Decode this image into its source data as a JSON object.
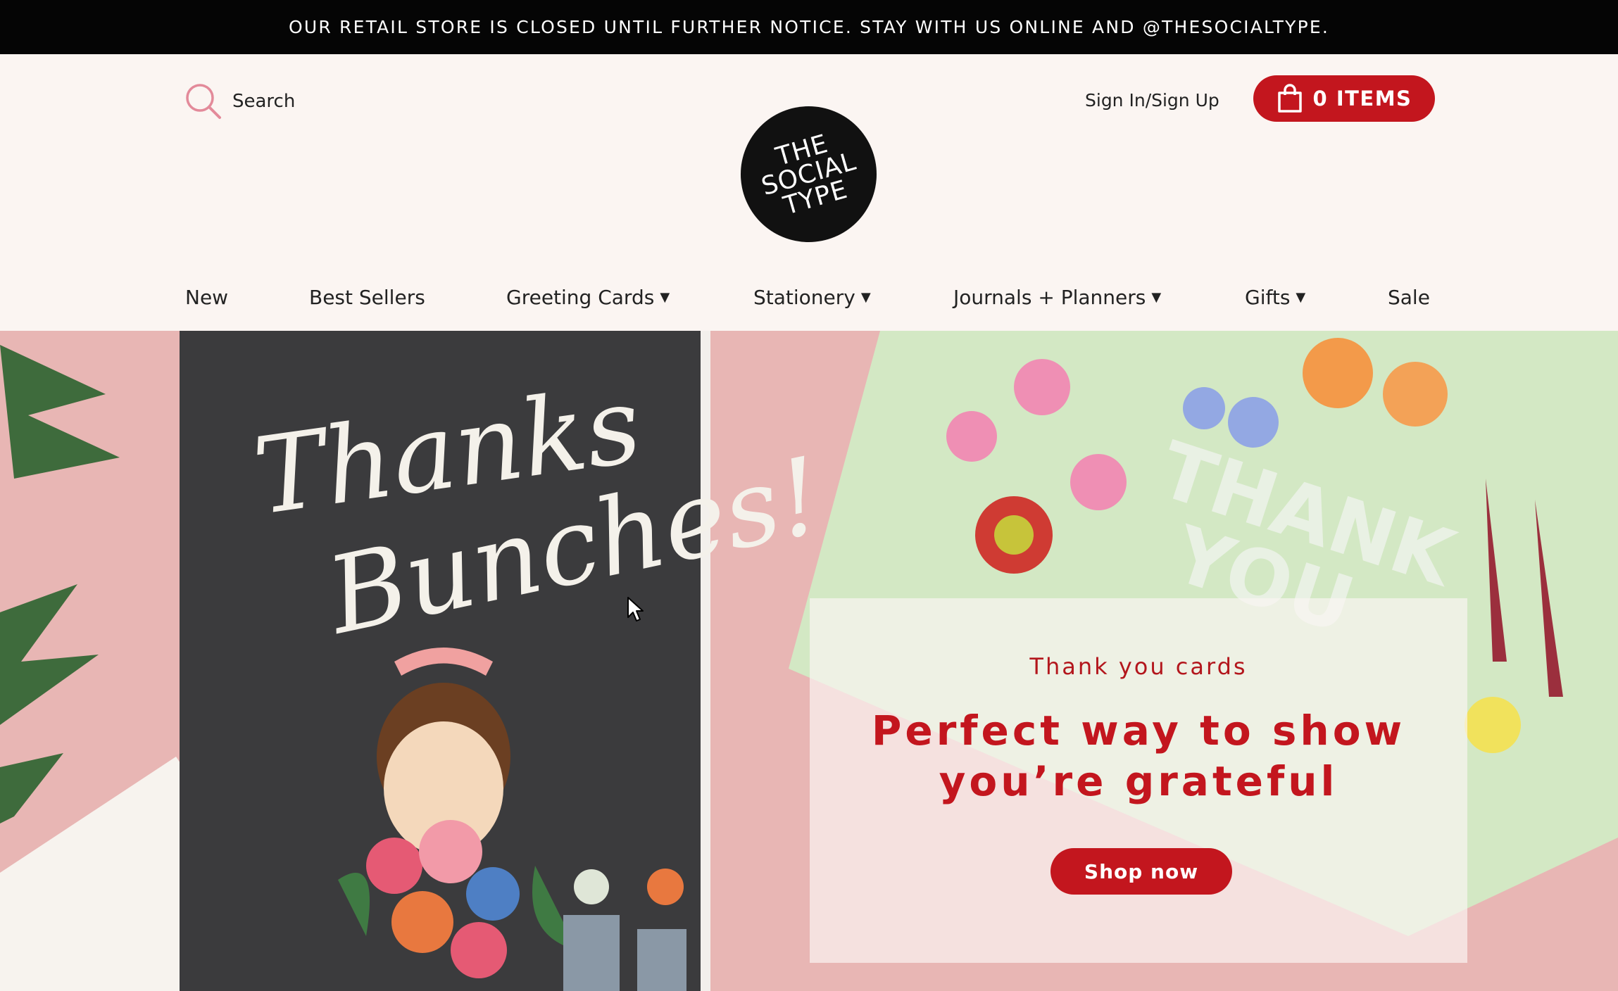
{
  "announcement": {
    "text": "OUR RETAIL STORE IS CLOSED UNTIL FURTHER NOTICE. STAY WITH US ONLINE AND @THESOCIALTYPE."
  },
  "header": {
    "search_label": "Search",
    "signin_label": "Sign In/Sign Up",
    "cart_label": "0 ITEMS",
    "logo": {
      "line1": "THE",
      "line2": "SOCIAL",
      "line3": "TYPE"
    }
  },
  "nav": {
    "items": [
      {
        "label": "New",
        "has_dropdown": false
      },
      {
        "label": "Best Sellers",
        "has_dropdown": false
      },
      {
        "label": "Greeting Cards",
        "has_dropdown": true
      },
      {
        "label": "Stationery",
        "has_dropdown": true
      },
      {
        "label": "Journals + Planners",
        "has_dropdown": true
      },
      {
        "label": "Gifts",
        "has_dropdown": true
      },
      {
        "label": "Sale",
        "has_dropdown": false
      }
    ],
    "caret_glyph": "▼"
  },
  "hero": {
    "card_left_text": "Thanks Bunches!",
    "card_right_text": "THANK YOU",
    "promo": {
      "eyebrow": "Thank you cards",
      "headline": "Perfect way to show you’re grateful",
      "button_label": "Shop now"
    }
  },
  "colors": {
    "brand_red": "#c3161e",
    "announcement_bg": "#050505",
    "header_bg": "#fbf5f2",
    "hero_bg": "#e8b6b4",
    "search_icon": "#e38a9a"
  },
  "icons": {
    "search": "search-icon",
    "cart": "shopping-bag-icon",
    "caret": "chevron-down-icon",
    "cursor": "mouse-pointer-icon"
  }
}
